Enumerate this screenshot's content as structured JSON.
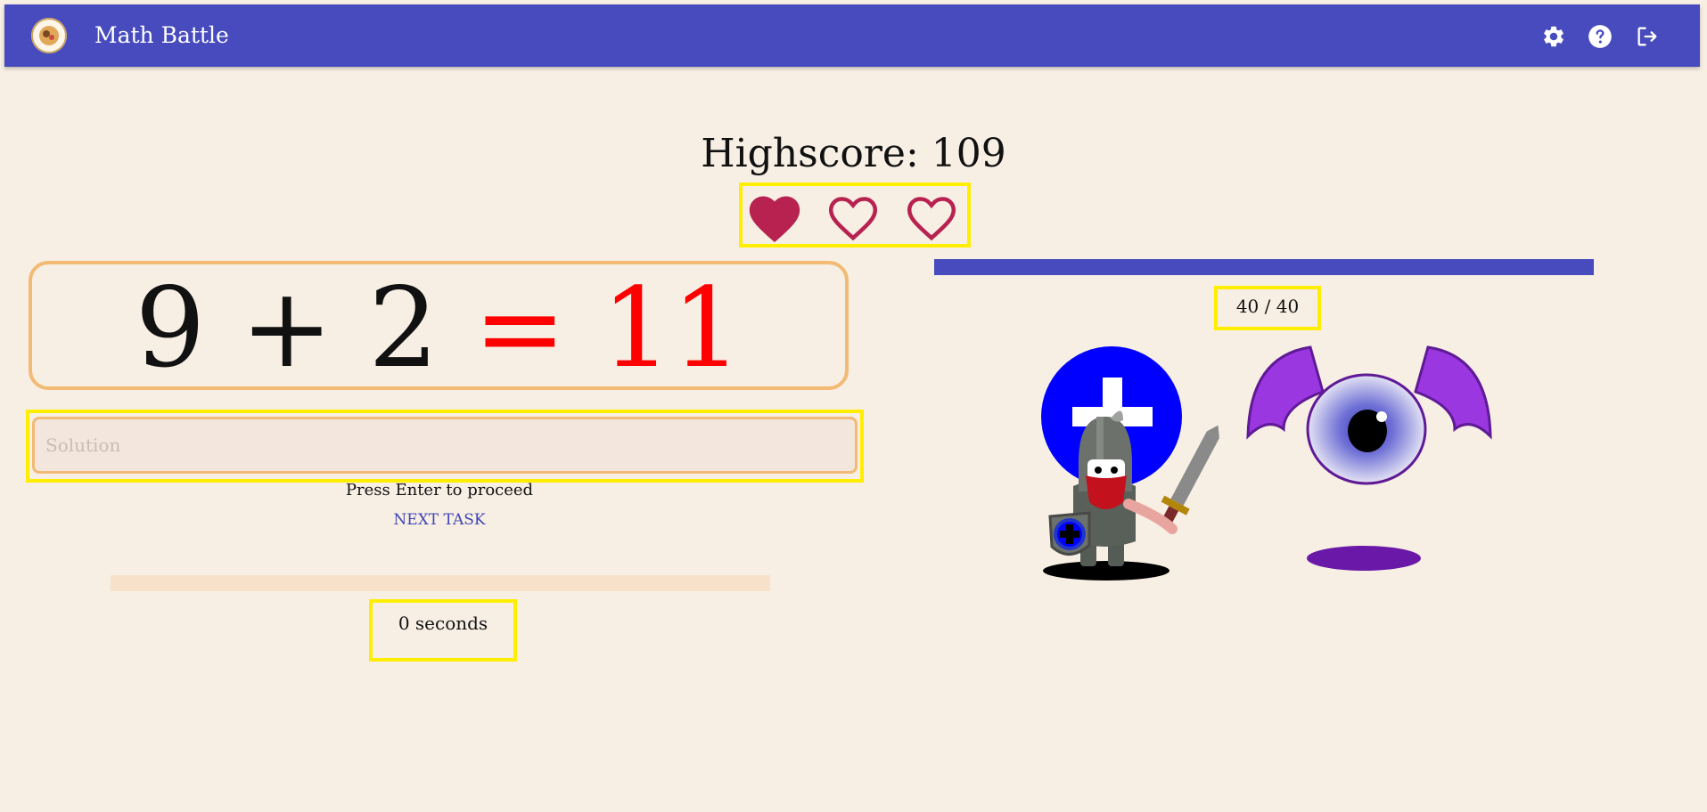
{
  "app": {
    "title": "Math Battle"
  },
  "toolbar": {
    "settings_icon": "gear-icon",
    "help_icon": "help-circle-icon",
    "logout_icon": "logout-icon"
  },
  "game": {
    "highscore_label": "Highscore:",
    "highscore_value": "109",
    "lives": {
      "total": 3,
      "filled": 1
    },
    "equation": {
      "operand_a": "9",
      "operator": "+",
      "operand_b": "2",
      "equals": "=",
      "answer": "11"
    },
    "solution": {
      "placeholder": "Solution",
      "value": ""
    },
    "hint": "Press Enter to proceed",
    "next_task_label": "NEXT TASK",
    "timer": {
      "text": "0 seconds",
      "progress": 0
    },
    "monster": {
      "hp_text": "40 / 40",
      "hp_fraction": 1.0
    }
  },
  "colors": {
    "appbar": "#474bbd",
    "background": "#f8efe4",
    "heart": "#b72250",
    "answer": "#ff0000",
    "highlight": "#ffee00",
    "card_border": "#f2ba74"
  }
}
